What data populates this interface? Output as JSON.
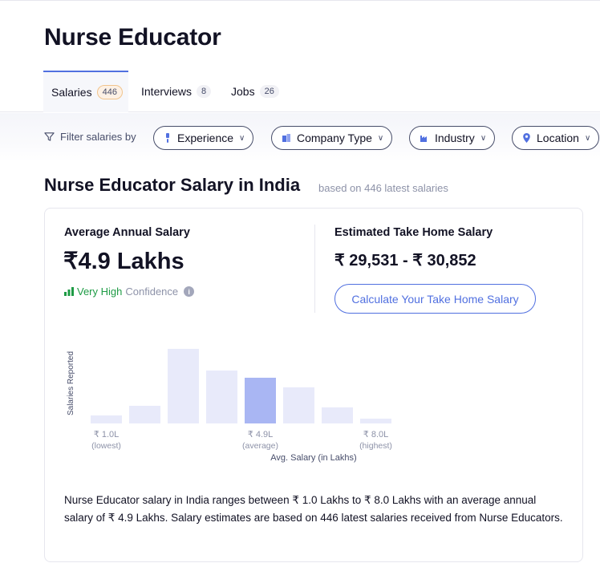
{
  "page_title": "Nurse Educator",
  "tabs": [
    {
      "label": "Salaries",
      "count": "446"
    },
    {
      "label": "Interviews",
      "count": "8"
    },
    {
      "label": "Jobs",
      "count": "26"
    }
  ],
  "filter": {
    "label": "Filter salaries by",
    "chips": [
      {
        "label": "Experience",
        "icon": "experience-icon"
      },
      {
        "label": "Company Type",
        "icon": "building-icon"
      },
      {
        "label": "Industry",
        "icon": "factory-icon"
      },
      {
        "label": "Location",
        "icon": "location-pin-icon"
      }
    ]
  },
  "section": {
    "title": "Nurse Educator Salary in India",
    "subtitle": "based on 446 latest salaries"
  },
  "card": {
    "avg_label": "Average Annual Salary",
    "avg_value": "₹4.9 Lakhs",
    "confidence_level": "Very High",
    "confidence_word": "Confidence",
    "take_home_label": "Estimated Take Home Salary",
    "take_home_value": "₹ 29,531 - ₹ 30,852",
    "calc_button": "Calculate Your Take Home Salary",
    "description": "Nurse Educator salary in India ranges between ₹ 1.0 Lakhs to ₹ 8.0 Lakhs with an average annual salary of ₹ 4.9 Lakhs. Salary estimates are based on 446 latest salaries received from Nurse Educators."
  },
  "chart_data": {
    "type": "bar",
    "ylabel": "Salaries Reported",
    "xlabel": "Avg. Salary (in Lakhs)",
    "values": [
      10,
      22,
      93,
      66,
      57,
      45,
      20,
      6
    ],
    "highlight_index": 4,
    "labels": [
      {
        "bar": 0,
        "value": "₹ 1.0L",
        "caption": "(lowest)"
      },
      {
        "bar": 4,
        "value": "₹ 4.9L",
        "caption": "(average)"
      },
      {
        "bar": 7,
        "value": "₹ 8.0L",
        "caption": "(highest)"
      }
    ],
    "colors": {
      "bar": "#e8eafa",
      "highlight": "#a9b6f3"
    }
  }
}
